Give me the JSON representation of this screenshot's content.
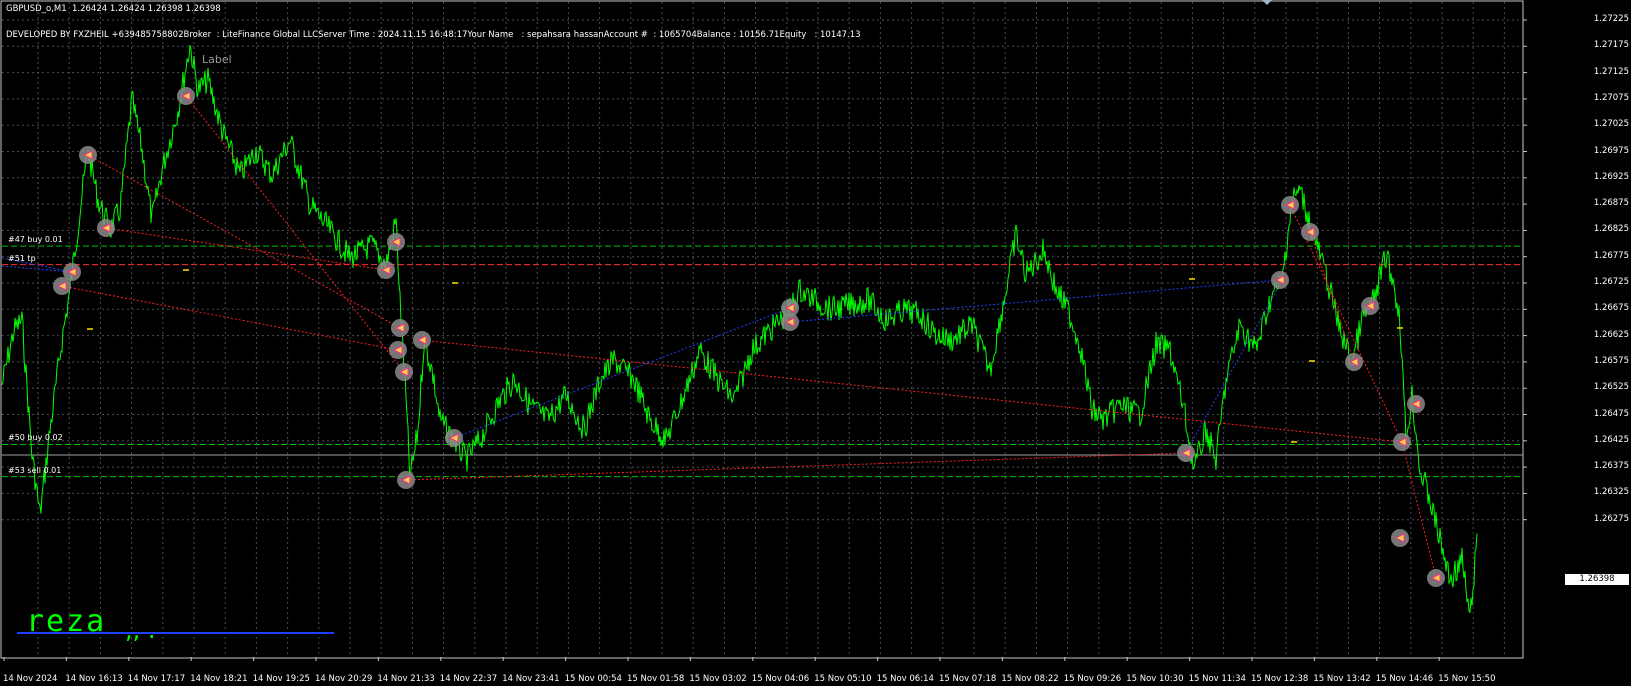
{
  "header": {
    "symbol_line": "GBPUSD_o,M1  1.26424 1.26424 1.26398 1.26398",
    "info_line": "DEVELOPED BY FXZHEIL +639485758802Broker  : LiteFinance Global LLCServer Time : 2024.11.15 16:48:17Your Name   : sepahsara hassanAccount #  : 1065704Balance : 10156.71Equity   : 10147.13"
  },
  "price_axis": [
    "1.27225",
    "1.27175",
    "1.27125",
    "1.27075",
    "1.27025",
    "1.26975",
    "1.26925",
    "1.26875",
    "1.26825",
    "1.26775",
    "1.26725",
    "1.26675",
    "1.26625",
    "1.26575",
    "1.26525",
    "1.26475",
    "1.26425",
    "1.26375",
    "1.26325",
    "1.26275"
  ],
  "current_price": "1.26398",
  "time_axis": [
    "14 Nov 2024",
    "14 Nov 16:13",
    "14 Nov 17:17",
    "14 Nov 18:21",
    "14 Nov 19:25",
    "14 Nov 20:29",
    "14 Nov 21:33",
    "14 Nov 22:37",
    "14 Nov 23:41",
    "15 Nov 00:54",
    "15 Nov 01:58",
    "15 Nov 03:02",
    "15 Nov 04:06",
    "15 Nov 05:10",
    "15 Nov 06:14",
    "15 Nov 07:18",
    "15 Nov 08:22",
    "15 Nov 09:26",
    "15 Nov 10:30",
    "15 Nov 11:34",
    "15 Nov 12:38",
    "15 Nov 13:42",
    "15 Nov 14:46",
    "15 Nov 15:50"
  ],
  "order_lines": [
    {
      "label": "#47 buy 0.01",
      "price": 1.26795
    },
    {
      "label": "#51 tp",
      "price": 1.2676
    },
    {
      "label": "#50 buy 0.02",
      "price": 1.26418
    },
    {
      "label": "#53 sell 0.01",
      "price": 1.26357
    }
  ],
  "object_label": "Label",
  "watermark_text": "reza",
  "watermark_dots": ",, .",
  "colors": {
    "background": "#000000",
    "grid": "#4a4f57",
    "price_line": "#00ff00",
    "buy_line": "#00c000",
    "tp_line": "#ff3030",
    "trade_red": "#ff2020",
    "trade_blue": "#2040ff",
    "marker": "#c0c0c0"
  }
}
